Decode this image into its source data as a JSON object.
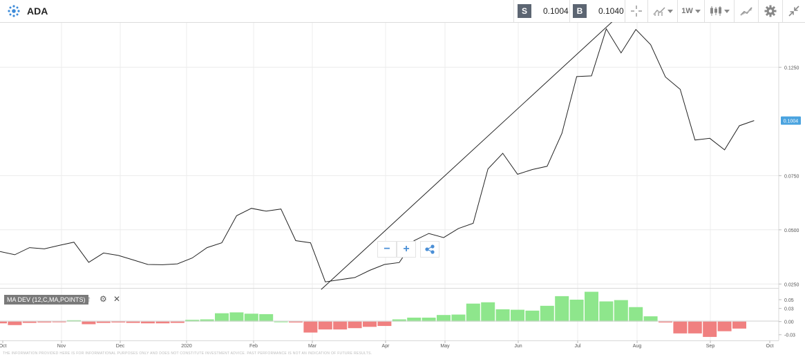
{
  "header": {
    "title": "ADA",
    "sell_label": "S",
    "sell_price": "0.1004",
    "buy_label": "B",
    "buy_price": "0.1040",
    "timeframe": "1W",
    "icons": [
      "crosshair-icon",
      "chart-type-icon",
      "candlestick-icon",
      "draw-tool-icon",
      "gear-icon",
      "collapse-icon"
    ]
  },
  "colors": {
    "line": "#222222",
    "positive_bar": "#8ee68c",
    "negative_bar": "#f08080",
    "price_marker": "#4aa3df",
    "grid": "#ececec"
  },
  "chart_data": {
    "type": "line",
    "price_axis": {
      "ticks": [
        "0.1250",
        "0.1004",
        "0.0750",
        "0.0500",
        "0.0250"
      ],
      "current_value": 0.1004,
      "ylim": [
        0.0235,
        0.1455
      ]
    },
    "month_labels": [
      "Oct",
      "Nov",
      "Dec",
      "2020",
      "Feb",
      "Mar",
      "Apr",
      "May",
      "Jun",
      "Jul",
      "Aug",
      "Sep",
      "Oct"
    ],
    "price_series": [
      0.04,
      0.0385,
      0.0418,
      0.0412,
      0.0428,
      0.0443,
      0.035,
      0.0393,
      0.0382,
      0.0361,
      0.034,
      0.0339,
      0.0343,
      0.037,
      0.0418,
      0.044,
      0.0565,
      0.0599,
      0.0586,
      0.0596,
      0.045,
      0.044,
      0.026,
      0.027,
      0.028,
      0.0313,
      0.034,
      0.0349,
      0.045,
      0.0483,
      0.0464,
      0.0506,
      0.053,
      0.0781,
      0.0853,
      0.0756,
      0.0778,
      0.0793,
      0.0945,
      0.1207,
      0.121,
      0.1427,
      0.1316,
      0.1424,
      0.1354,
      0.1205,
      0.1148,
      0.0914,
      0.0922,
      0.0869,
      0.098,
      0.1004
    ],
    "trendline": {
      "from": [
        22,
        0.025
      ],
      "to": [
        41,
        0.1445
      ]
    },
    "indicator": {
      "name": "MA DEV (12,C,MA,POINTS)",
      "ticks": [
        "0.05",
        "0.03",
        "0.00",
        "-0.03"
      ],
      "ylim": [
        -0.043,
        0.072
      ],
      "values": [
        -0.004,
        -0.008,
        -0.003,
        -0.002,
        -0.001,
        0.003,
        -0.006,
        -0.003,
        -0.002,
        -0.003,
        -0.004,
        -0.004,
        -0.003,
        0.004,
        0.005,
        0.019,
        0.021,
        0.018,
        0.017,
        0.0,
        -0.002,
        -0.025,
        -0.018,
        -0.018,
        -0.015,
        -0.012,
        -0.01,
        0.005,
        0.009,
        0.009,
        0.015,
        0.016,
        0.041,
        0.044,
        0.028,
        0.027,
        0.025,
        0.036,
        0.058,
        0.05,
        0.068,
        0.046,
        0.049,
        0.033,
        0.012,
        -0.002,
        -0.027,
        -0.027,
        -0.035,
        -0.022,
        -0.016
      ]
    }
  },
  "zoom": {
    "minus": "−",
    "plus": "+"
  },
  "footer": {
    "text": "THE INFORMATION PROVIDED HERE IS FOR INFORMATIONAL PURPOSES ONLY AND DOES NOT CONSTITUTE INVESTMENT ADVICE. PAST PERFORMANCE IS NOT AN INDICATION OF FUTURE RESULTS."
  }
}
